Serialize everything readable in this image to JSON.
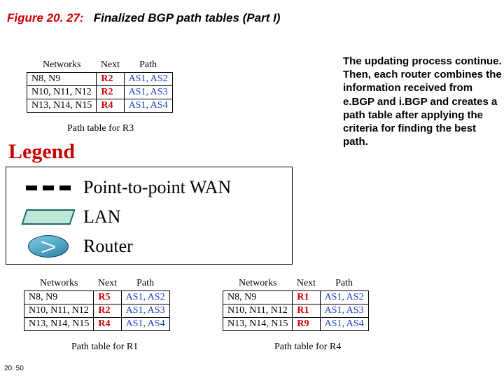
{
  "figure": {
    "number": "Figure 20. 27:",
    "name": "Finalized BGP path tables (Part I)"
  },
  "description": "The updating process continue. Then, each router combines the information received from e.BGP and i.BGP and creates a path table after applying the criteria for finding the best path.",
  "tables": {
    "r3": {
      "headers": {
        "net": "Networks",
        "next": "Next",
        "path": "Path"
      },
      "rows": [
        {
          "net": "N8, N9",
          "next": "R2",
          "path": "AS1, AS2"
        },
        {
          "net": "N10, N11, N12",
          "next": "R2",
          "path": "AS1, AS3"
        },
        {
          "net": "N13, N14, N15",
          "next": "R4",
          "path": "AS1, AS4"
        }
      ],
      "caption": "Path table for R3"
    },
    "r1": {
      "headers": {
        "net": "Networks",
        "next": "Next",
        "path": "Path"
      },
      "rows": [
        {
          "net": "N8, N9",
          "next": "R5",
          "path": "AS1, AS2"
        },
        {
          "net": "N10, N11, N12",
          "next": "R2",
          "path": "AS1, AS3"
        },
        {
          "net": "N13, N14, N15",
          "next": "R4",
          "path": "AS1, AS4"
        }
      ],
      "caption": "Path table for R1"
    },
    "r4": {
      "headers": {
        "net": "Networks",
        "next": "Next",
        "path": "Path"
      },
      "rows": [
        {
          "net": "N8, N9",
          "next": "R1",
          "path": "AS1, AS2"
        },
        {
          "net": "N10, N11, N12",
          "next": "R1",
          "path": "AS1, AS3"
        },
        {
          "net": "N13, N14, N15",
          "next": "R9",
          "path": "AS1, AS4"
        }
      ],
      "caption": "Path table for R4"
    }
  },
  "legend": {
    "title": "Legend",
    "items": [
      {
        "key": "p2p",
        "label": "Point-to-point WAN"
      },
      {
        "key": "lan",
        "label": "LAN"
      },
      {
        "key": "router",
        "label": "Router"
      }
    ]
  },
  "slide_number": "20. 50"
}
